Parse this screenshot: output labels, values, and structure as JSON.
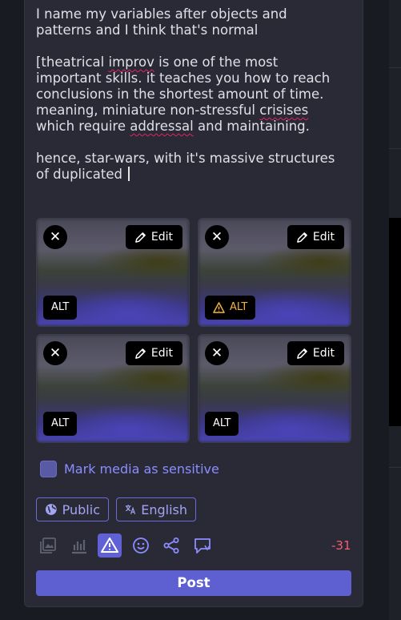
{
  "compose": {
    "line1": "I name my variables after objects and",
    "line2": "patterns and I think that's normal",
    "p2_a": "[theatrical ",
    "p2_improv": "improv",
    "p2_b": " is one of the most",
    "p2_line2": "important skills. it teaches you how to reach",
    "p2_line3": "conclusions in the shortest amount of time.",
    "p2_line4a": "meaning, miniature non-stressful ",
    "p2_crisises": "crisises",
    "p2_line5a": "which require ",
    "p2_addressal": "addressal",
    "p2_line5b": " and maintaining.",
    "p3_line1": "hence, star-wars, with it's massive structures",
    "p3_line2": "of duplicated "
  },
  "media": [
    {
      "remove_icon": "close-icon",
      "edit_label": "Edit",
      "alt_label": "ALT",
      "alt_warning": false
    },
    {
      "remove_icon": "close-icon",
      "edit_label": "Edit",
      "alt_label": "ALT",
      "alt_warning": true
    },
    {
      "remove_icon": "close-icon",
      "edit_label": "Edit",
      "alt_label": "ALT",
      "alt_warning": false
    },
    {
      "remove_icon": "close-icon",
      "edit_label": "Edit",
      "alt_label": "ALT",
      "alt_warning": false
    }
  ],
  "sensitive_label": "Mark media as sensitive",
  "visibility_label": "Public",
  "language_label": "English",
  "toolbar": [
    "image-icon",
    "poll-icon",
    "warning-icon",
    "emoji-icon",
    "share-icon",
    "quote-icon"
  ],
  "char_count": "-31",
  "post_label": "Post",
  "colors": {
    "accent": "#5e5fd1",
    "danger": "#ff5a70",
    "warn": "#f2b33d",
    "panel": "#292a36"
  }
}
